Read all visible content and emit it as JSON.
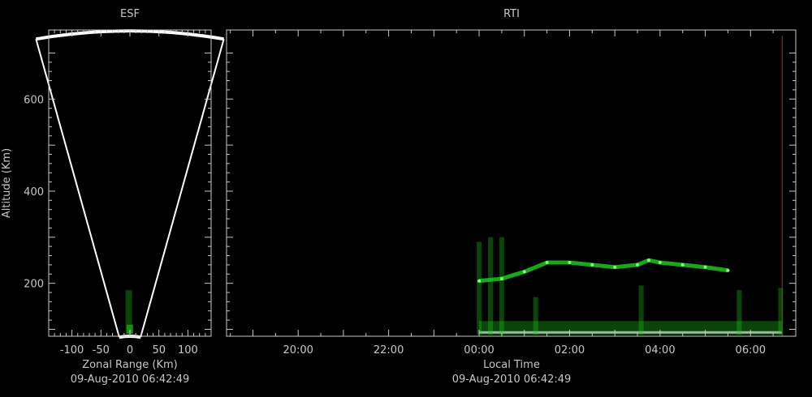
{
  "colors": {
    "background": "#000000",
    "axis": "#c8c8c8",
    "fan": "#ffffff",
    "echo": "#1fc41f",
    "now_marker": "#c81e1e"
  },
  "esf": {
    "title": "ESF",
    "xlabel": "Zonal Range (Km)",
    "ylabel": "Altitude (Km)",
    "timestamp": "09-Aug-2010 06:42:49",
    "x_ticks": [
      "-100",
      "-50",
      "0",
      "50",
      "100"
    ],
    "y_ticks": [
      "200",
      "400",
      "600"
    ]
  },
  "rti": {
    "title": "RTI",
    "xlabel": "Local Time",
    "timestamp": "09-Aug-2010 06:42:49",
    "x_ticks": [
      "20:00",
      "22:00",
      "00:00",
      "02:00",
      "04:00",
      "06:00"
    ]
  },
  "chart_data": [
    {
      "type": "heatmap",
      "title": "ESF",
      "xlabel": "Zonal Range (Km)",
      "ylabel": "Altitude (Km)",
      "xlim": [
        -140,
        140
      ],
      "ylim": [
        85,
        750
      ],
      "grid": false,
      "fan": {
        "half_angle_deg": 12.5,
        "min_range_km": 85,
        "max_range_km": 748
      },
      "echoes": [
        {
          "x": -2,
          "y_from": 90,
          "y_to": 185,
          "strength": "weak"
        },
        {
          "x": 0,
          "y_from": 90,
          "y_to": 110,
          "strength": "moderate"
        }
      ]
    },
    {
      "type": "heatmap",
      "title": "RTI",
      "xlabel": "Local Time",
      "ylabel": "Altitude (Km)",
      "xlim": [
        "18:25",
        "07:00"
      ],
      "ylim": [
        85,
        750
      ],
      "grid": false,
      "now_marker_time": "06:42",
      "layer_trace": [
        {
          "t": "00:00",
          "alt": 205
        },
        {
          "t": "00:30",
          "alt": 210
        },
        {
          "t": "01:00",
          "alt": 225
        },
        {
          "t": "01:30",
          "alt": 245
        },
        {
          "t": "02:00",
          "alt": 245
        },
        {
          "t": "02:30",
          "alt": 240
        },
        {
          "t": "03:00",
          "alt": 235
        },
        {
          "t": "03:30",
          "alt": 240
        },
        {
          "t": "03:45",
          "alt": 250
        },
        {
          "t": "04:00",
          "alt": 245
        },
        {
          "t": "04:30",
          "alt": 240
        },
        {
          "t": "05:00",
          "alt": 235
        },
        {
          "t": "05:30",
          "alt": 228
        }
      ],
      "bottom_echo": {
        "t_from": "00:00",
        "t_to": "06:42",
        "alt_from": 88,
        "alt_to": 118
      },
      "plumes": [
        {
          "t": "00:00",
          "alt_to": 290
        },
        {
          "t": "00:15",
          "alt_to": 300
        },
        {
          "t": "00:30",
          "alt_to": 300
        },
        {
          "t": "01:15",
          "alt_to": 170
        },
        {
          "t": "03:35",
          "alt_to": 195
        },
        {
          "t": "05:45",
          "alt_to": 185
        },
        {
          "t": "06:40",
          "alt_to": 190
        }
      ]
    }
  ]
}
